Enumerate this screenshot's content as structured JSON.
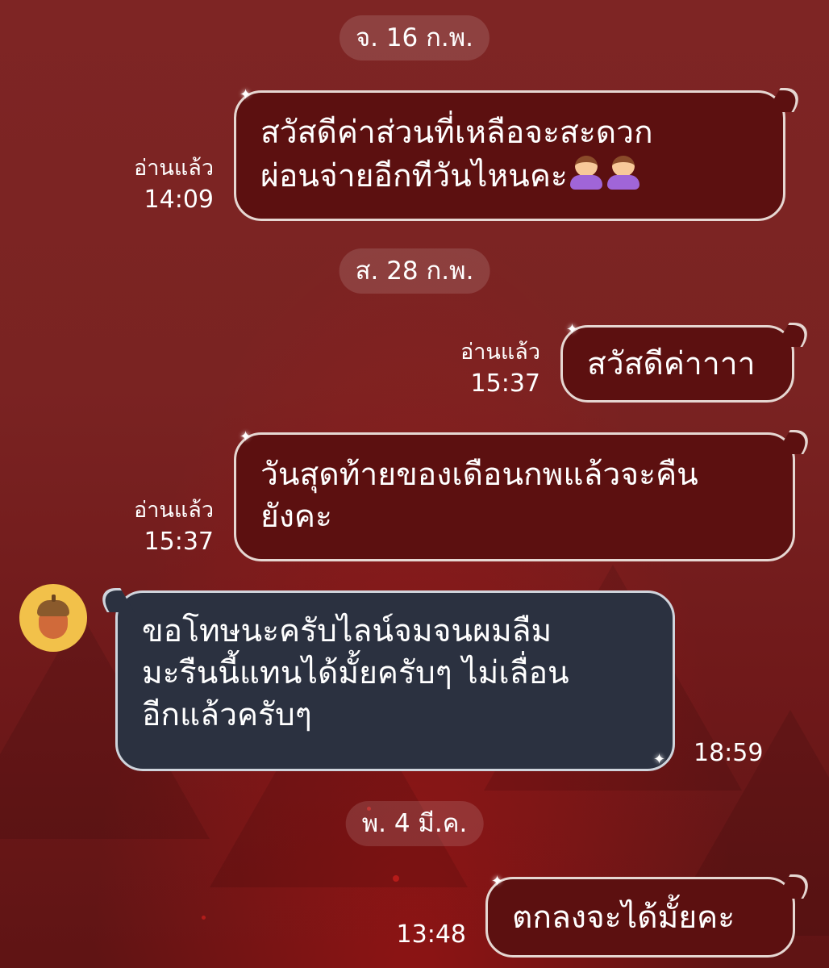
{
  "dates": {
    "d1": "จ. 16 ก.พ.",
    "d2": "ส. 28 ก.พ.",
    "d3": "พ. 4 มี.ค."
  },
  "messages": [
    {
      "direction": "outgoing",
      "lines": [
        "สวัสดีค่าส่วนที่เหลือจะสะดวก",
        "ผ่อนจ่ายอีกทีวันไหนคะ"
      ],
      "emoji": [
        "person-bowing-icon",
        "person-bowing-icon"
      ],
      "read_label": "อ่านแล้ว",
      "time": "14:09"
    },
    {
      "direction": "outgoing",
      "lines": [
        "สวัสดีค่าาาา"
      ],
      "read_label": "อ่านแล้ว",
      "time": "15:37"
    },
    {
      "direction": "outgoing",
      "lines": [
        "วันสุดท้ายของเดือนกพแล้วจะคืน",
        "ยังคะ"
      ],
      "read_label": "อ่านแล้ว",
      "time": "15:37"
    },
    {
      "direction": "incoming",
      "avatar_icon": "acorn-icon",
      "lines": [
        "ขอโทษนะครับไลน์จมจนผมลืม",
        "มะรืนนี้แทนได้มั้ยครับๆ ไม่เลื่อน",
        "อีกแล้วครับๆ"
      ],
      "time": "18:59"
    },
    {
      "direction": "outgoing",
      "lines": [
        "ตกลงจะได้มั้ยคะ"
      ],
      "time": "13:48"
    }
  ],
  "colors": {
    "background": "#7a2322",
    "outgoing_bubble": "#5c1010",
    "incoming_bubble": "#2b3140",
    "bubble_border": "#e6d7d2"
  }
}
